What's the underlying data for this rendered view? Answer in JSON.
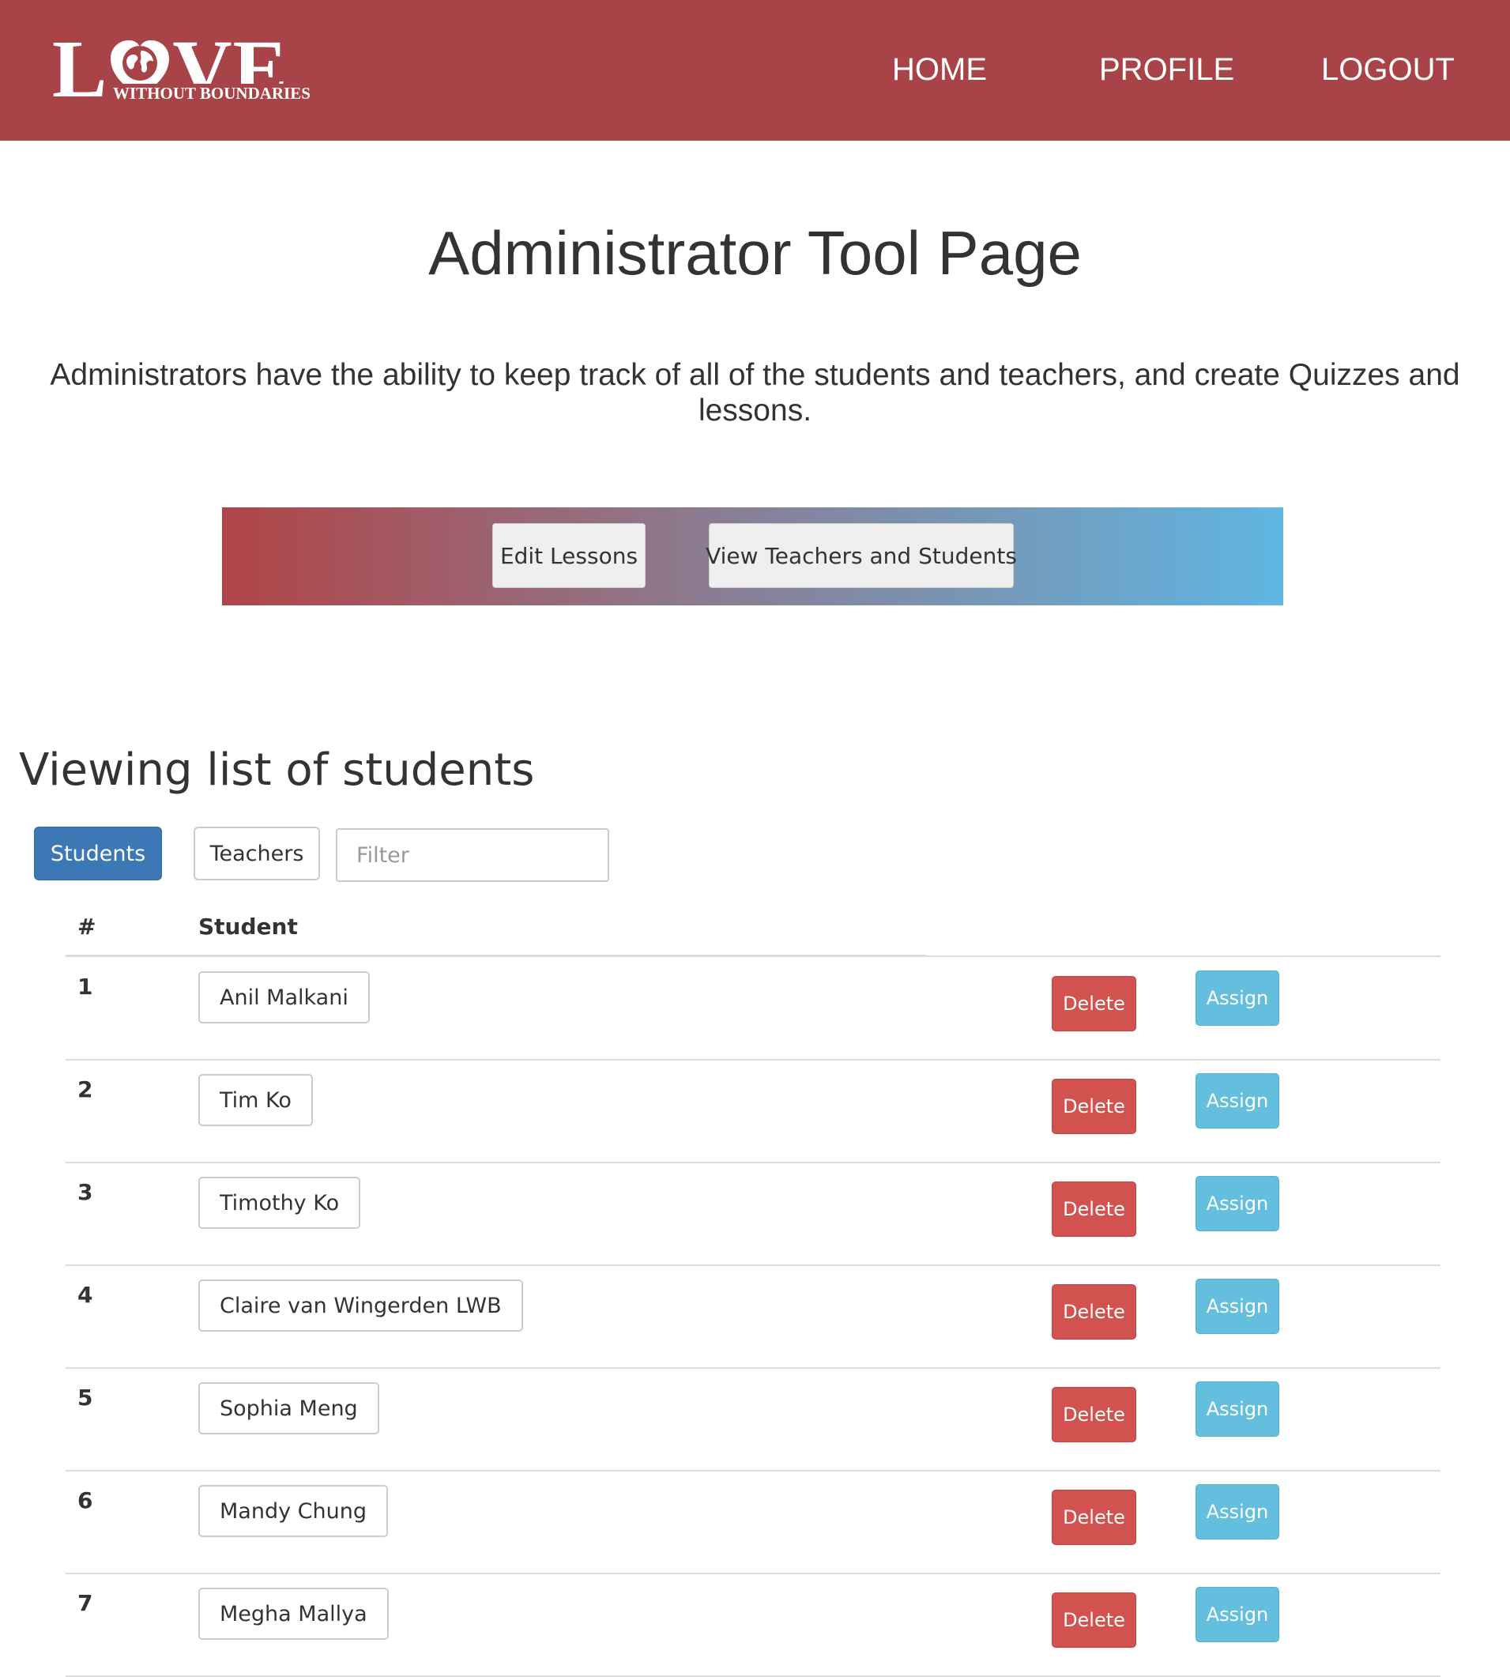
{
  "brand": {
    "logo_word": "LOVE",
    "logo_sub": "WITHOUT BOUNDARIES",
    "color": "#a84448"
  },
  "nav": {
    "home": "HOME",
    "profile": "PROFILE",
    "logout": "LOGOUT"
  },
  "page": {
    "title": "Administrator Tool Page",
    "description": "Administrators have the ability to keep track of all of the students and teachers, and create Quizzes and lessons."
  },
  "actions": {
    "edit_lessons": "Edit Lessons",
    "view_people": "View Teachers and Students"
  },
  "list": {
    "heading": "Viewing list of students",
    "toggle_students": "Students",
    "toggle_teachers": "Teachers",
    "filter_placeholder": "Filter",
    "filter_value": ""
  },
  "table": {
    "col_num": "#",
    "col_student": "Student",
    "delete_label": "Delete",
    "assign_label": "Assign",
    "rows": [
      {
        "num": "1",
        "name": "Anil Malkani"
      },
      {
        "num": "2",
        "name": "Tim Ko"
      },
      {
        "num": "3",
        "name": "Timothy Ko"
      },
      {
        "num": "4",
        "name": "Claire van Wingerden LWB"
      },
      {
        "num": "5",
        "name": "Sophia Meng"
      },
      {
        "num": "6",
        "name": "Mandy Chung"
      },
      {
        "num": "7",
        "name": "Megha Mallya"
      }
    ]
  },
  "colors": {
    "primary": "#3d78b6",
    "danger": "#d1524e",
    "info": "#63bfdd",
    "gradient_start": "#b14447",
    "gradient_end": "#5fb6e2"
  },
  "icons": {
    "logo_globe": "globe-icon"
  }
}
